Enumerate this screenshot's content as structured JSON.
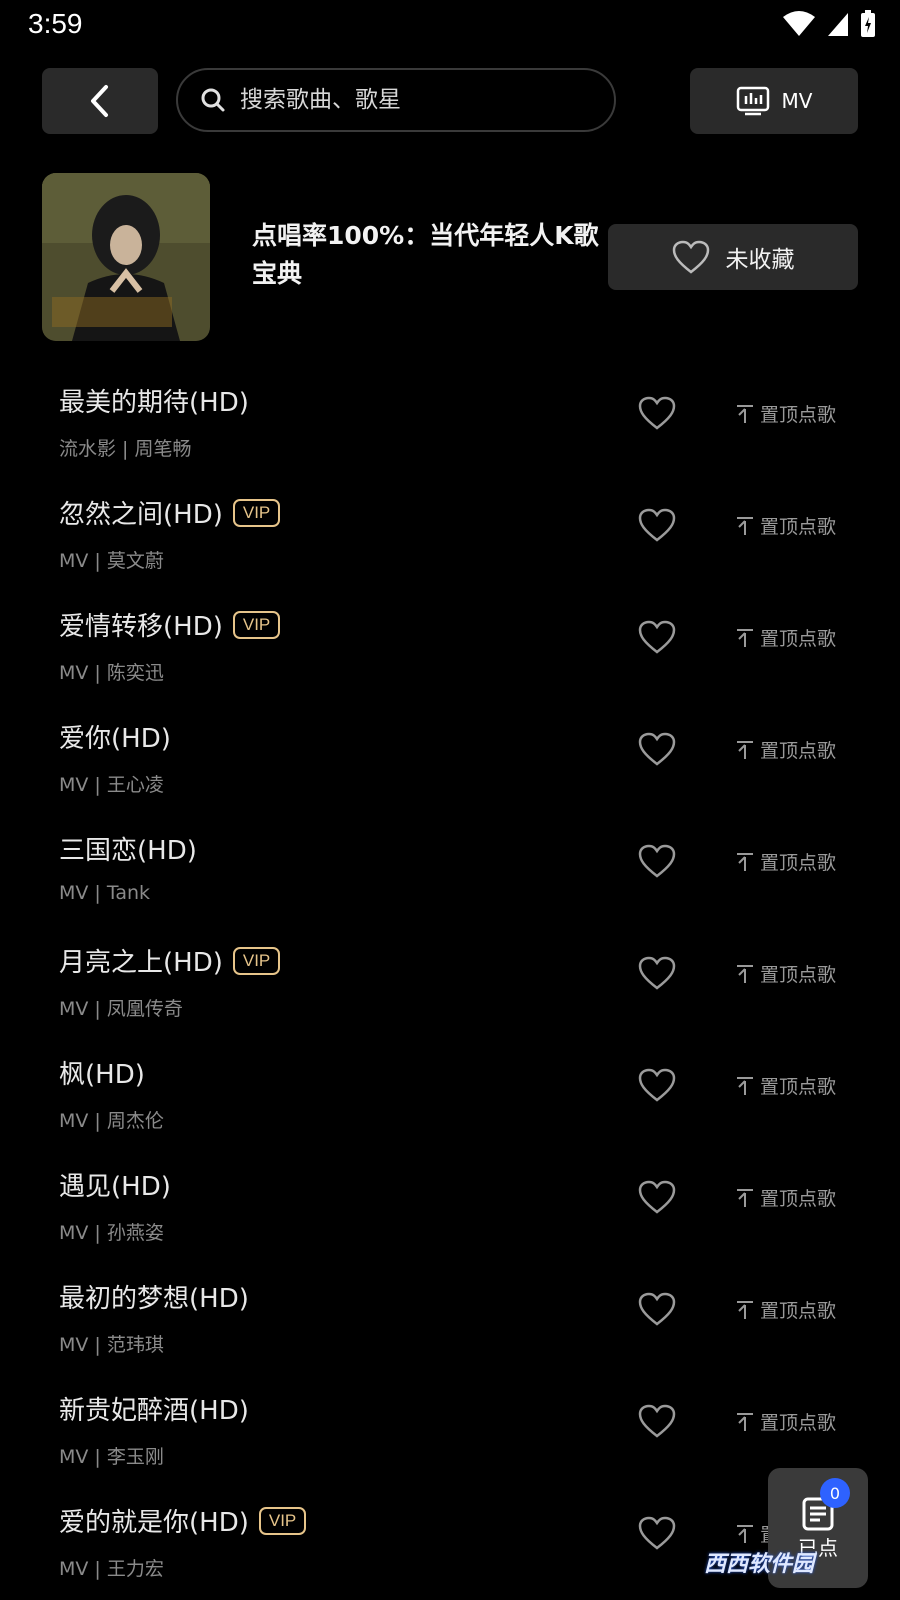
{
  "status": {
    "time": "3:59"
  },
  "topbar": {
    "search_placeholder": "搜索歌曲、歌星",
    "mv_label": "MV"
  },
  "album": {
    "title": "点唱率100%：当代年轻人K歌宝典",
    "favorite_label": "未收藏"
  },
  "pin_label": "置顶点歌",
  "vip_label": "VIP",
  "songs": [
    {
      "title": "最美的期待(HD)",
      "sub": "流水影 | 周笔畅",
      "vip": false
    },
    {
      "title": "忽然之间(HD)",
      "sub": "MV | 莫文蔚",
      "vip": true
    },
    {
      "title": "爱情转移(HD)",
      "sub": "MV | 陈奕迅",
      "vip": true
    },
    {
      "title": "爱你(HD)",
      "sub": "MV | 王心凌",
      "vip": false
    },
    {
      "title": "三国恋(HD)",
      "sub": "MV | Tank",
      "vip": false
    },
    {
      "title": "月亮之上(HD)",
      "sub": "MV | 凤凰传奇",
      "vip": true
    },
    {
      "title": "枫(HD)",
      "sub": "MV | 周杰伦",
      "vip": false
    },
    {
      "title": "遇见(HD)",
      "sub": "MV | 孙燕姿",
      "vip": false
    },
    {
      "title": "最初的梦想(HD)",
      "sub": "MV | 范玮琪",
      "vip": false
    },
    {
      "title": "新贵妃醉酒(HD)",
      "sub": "MV | 李玉刚",
      "vip": false
    },
    {
      "title": "爱的就是你(HD)",
      "sub": "MV | 王力宏",
      "vip": true
    }
  ],
  "queue": {
    "label": "已点",
    "count": "0"
  },
  "watermark": "西西软件园"
}
